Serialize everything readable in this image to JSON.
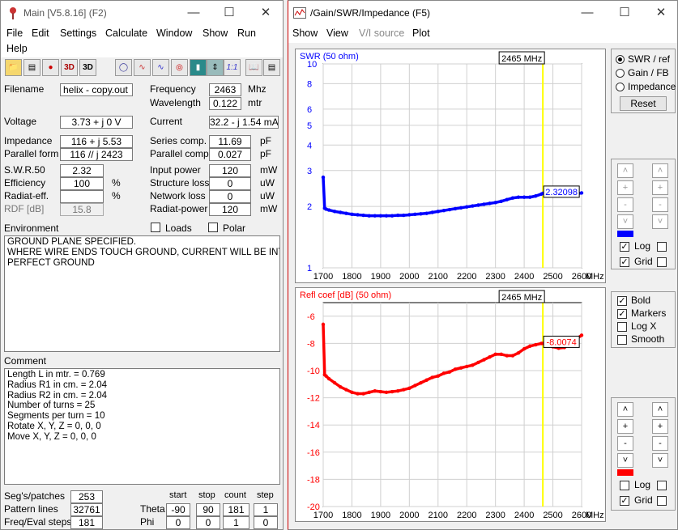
{
  "main": {
    "title": "Main [V5.8.16]  (F2)",
    "menu": [
      "File",
      "Edit",
      "Settings",
      "Calculate",
      "Window",
      "Show",
      "Run",
      "Help"
    ],
    "toolbar_icons": [
      "open-icon",
      "save-icon",
      "calculator-icon",
      "3d-icon",
      "3d-cube-icon",
      "circle-icon",
      "wave-icon",
      "graph-icon",
      "target-icon",
      "battery-icon",
      "arrows-icon",
      "ratio-icon",
      "book-icon",
      "text-icon"
    ],
    "toolbar_ratio_label": "1:1",
    "filename_label": "Filename",
    "filename": "helix - copy.out",
    "frequency_label": "Frequency",
    "frequency": "2463",
    "frequency_unit": "Mhz",
    "wavelength_label": "Wavelength",
    "wavelength": "0.122",
    "wavelength_unit": "mtr",
    "voltage_label": "Voltage",
    "voltage": "3.73 + j 0 V",
    "current_label": "Current",
    "current": "32.2 - j 1.54 mA",
    "impedance_label": "Impedance",
    "impedance": "116 + j 5.53",
    "parallel_form_label": "Parallel form",
    "parallel_form": "116 // j 2423",
    "series_comp_label": "Series comp.",
    "series_comp": "11.69",
    "series_comp_unit": "pF",
    "parallel_comp_label": "Parallel comp.",
    "parallel_comp": "0.027",
    "parallel_comp_unit": "pF",
    "swr_label": "S.W.R.50",
    "swr": "2.32",
    "efficiency_label": "Efficiency",
    "efficiency": "100",
    "efficiency_unit": "%",
    "radiat_eff_label": "Radiat-eff.",
    "radiat_eff": "",
    "radiat_eff_unit": "%",
    "rdf_label": "RDF [dB]",
    "rdf": "15.8",
    "input_power_label": "Input power",
    "input_power": "120",
    "input_power_unit": "mW",
    "structure_loss_label": "Structure loss",
    "structure_loss": "0",
    "structure_loss_unit": "uW",
    "network_loss_label": "Network loss",
    "network_loss": "0",
    "network_loss_unit": "uW",
    "radiat_power_label": "Radiat-power",
    "radiat_power": "120",
    "radiat_power_unit": "mW",
    "environment_label": "Environment",
    "loads_label": "Loads",
    "loads_checked": false,
    "polar_label": "Polar",
    "polar_checked": false,
    "environment_text": "GROUND PLANE SPECIFIED.\nWHERE WIRE ENDS TOUCH GROUND, CURRENT WILL BE INTER\nPERFECT GROUND",
    "comment_label": "Comment",
    "comment_text": "Length L in mtr. = 0.769\nRadius R1 in cm. = 2.04\nRadius R2 in cm. = 2.04\nNumber of turns = 25\nSegments per turn = 10\nRotate X, Y, Z = 0, 0, 0\nMove X, Y, Z = 0, 0, 0",
    "segs_patches_label": "Seg's/patches",
    "segs_patches": "253",
    "pattern_lines_label": "Pattern lines",
    "pattern_lines": "32761",
    "freq_eval_label": "Freq/Eval steps",
    "freq_eval": "181",
    "col_start": "start",
    "col_stop": "stop",
    "col_count": "count",
    "col_step": "step",
    "theta_label": "Theta",
    "theta": [
      "-90",
      "90",
      "181",
      "1"
    ],
    "phi_label": "Phi",
    "phi": [
      "0",
      "0",
      "1",
      "0"
    ]
  },
  "gain": {
    "title": "/Gain/SWR/Impedance  (F5)",
    "menu": [
      "Show",
      "View",
      "V/I source",
      "Plot"
    ],
    "radio_swr": "SWR / ref",
    "radio_gain": "Gain / FB",
    "radio_impedance": "Impedance",
    "reset_button": "Reset",
    "log_label": "Log",
    "grid_label": "Grid",
    "bold_label": "Bold",
    "markers_label": "Markers",
    "logx_label": "Log X",
    "smooth_label": "Smooth",
    "bold_checked": true,
    "markers_checked": true,
    "logx_checked": false,
    "smooth_checked": false,
    "top_log_checked": true,
    "top_grid_checked": true,
    "bottom_log_checked": false,
    "bottom_grid_checked": true,
    "top_color": "#0000ff",
    "bottom_color": "#ff0000",
    "marker_color": "#ffff00"
  },
  "chart_data": [
    {
      "type": "line",
      "title": "SWR (50 ohm)",
      "marker_label": "2465 MHz",
      "marker_x": 2465,
      "value_label": "2.32098",
      "x_unit": "MHz",
      "xlim": [
        1700,
        2600
      ],
      "ylim": [
        1,
        10
      ],
      "yscale": "log",
      "yticks": [
        "1",
        "2",
        "3",
        "4",
        "5",
        "6",
        "8",
        "10"
      ],
      "xticks": [
        "1700",
        "1800",
        "1900",
        "2000",
        "2100",
        "2200",
        "2300",
        "2400",
        "2500",
        "2600"
      ],
      "x": [
        1700,
        1705,
        1710,
        1720,
        1740,
        1760,
        1780,
        1800,
        1820,
        1840,
        1860,
        1880,
        1900,
        1920,
        1940,
        1960,
        1980,
        2000,
        2020,
        2040,
        2060,
        2080,
        2100,
        2120,
        2140,
        2160,
        2180,
        2200,
        2220,
        2240,
        2260,
        2280,
        2300,
        2320,
        2340,
        2360,
        2380,
        2400,
        2420,
        2440,
        2460,
        2465,
        2480,
        2500,
        2520,
        2540,
        2560,
        2580,
        2600
      ],
      "y": [
        2.78,
        1.96,
        1.94,
        1.92,
        1.89,
        1.87,
        1.85,
        1.83,
        1.82,
        1.81,
        1.8,
        1.8,
        1.8,
        1.8,
        1.8,
        1.81,
        1.81,
        1.82,
        1.83,
        1.84,
        1.85,
        1.87,
        1.89,
        1.91,
        1.93,
        1.95,
        1.97,
        1.99,
        2.01,
        2.03,
        2.05,
        2.07,
        2.09,
        2.12,
        2.16,
        2.2,
        2.22,
        2.22,
        2.22,
        2.25,
        2.3,
        2.32,
        2.33,
        2.31,
        2.27,
        2.27,
        2.27,
        2.3,
        2.33
      ]
    },
    {
      "type": "line",
      "title": "Refl coef [dB] (50 ohm)",
      "marker_label": "2465 MHz",
      "marker_x": 2465,
      "value_label": "-8.0074",
      "x_unit": "MHz",
      "xlim": [
        1700,
        2600
      ],
      "ylim": [
        -20,
        -5
      ],
      "yticks": [
        "-6",
        "-8",
        "-10",
        "-12",
        "-14",
        "-16",
        "-18",
        "-20"
      ],
      "xticks": [
        "1700",
        "1800",
        "1900",
        "2000",
        "2100",
        "2200",
        "2300",
        "2400",
        "2500",
        "2600"
      ],
      "x": [
        1700,
        1705,
        1710,
        1720,
        1740,
        1760,
        1780,
        1800,
        1820,
        1840,
        1860,
        1880,
        1900,
        1920,
        1940,
        1960,
        1980,
        2000,
        2020,
        2040,
        2060,
        2080,
        2100,
        2120,
        2140,
        2160,
        2180,
        2200,
        2220,
        2240,
        2260,
        2280,
        2300,
        2320,
        2340,
        2360,
        2380,
        2400,
        2420,
        2440,
        2460,
        2465,
        2480,
        2500,
        2520,
        2540,
        2560,
        2580,
        2600
      ],
      "y": [
        -6.6,
        -10.3,
        -10.4,
        -10.6,
        -10.9,
        -11.2,
        -11.4,
        -11.6,
        -11.7,
        -11.7,
        -11.6,
        -11.5,
        -11.55,
        -11.6,
        -11.55,
        -11.5,
        -11.4,
        -11.3,
        -11.1,
        -10.9,
        -10.7,
        -10.5,
        -10.4,
        -10.2,
        -10.1,
        -9.9,
        -9.8,
        -9.7,
        -9.6,
        -9.4,
        -9.2,
        -9.0,
        -8.8,
        -8.8,
        -8.9,
        -8.9,
        -8.7,
        -8.4,
        -8.2,
        -8.1,
        -8.0,
        -8.0,
        -8.1,
        -8.25,
        -8.35,
        -8.3,
        -8.0,
        -7.7,
        -7.4
      ]
    }
  ]
}
